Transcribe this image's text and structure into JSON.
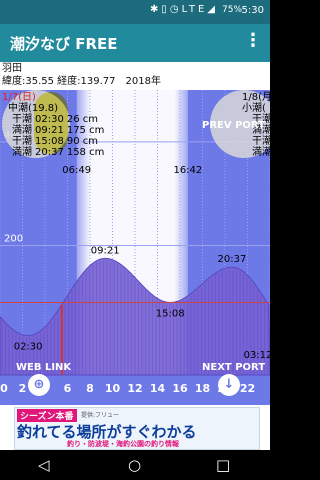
{
  "status_bar": {
    "time": "5:30",
    "battery": "75%",
    "network": "LTE",
    "icons": [
      "bluetooth-icon",
      "vibrate-icon",
      "alarm-icon",
      "wifi-icon",
      "signal-icon",
      "battery-icon"
    ]
  },
  "app_bar": {
    "title": "潮汐なび FREE",
    "menu_icon": "overflow-menu-icon"
  },
  "location": {
    "name": "羽田",
    "coords": "緯度:35.55 経度:139.77　2018年"
  },
  "left_panel": {
    "date": "1/7(日)",
    "tide_type": "中潮(19.8)",
    "rows": [
      {
        "label": "干潮",
        "time": "02:30",
        "level": "26 cm"
      },
      {
        "label": "満潮",
        "time": "09:21",
        "level": "175 cm"
      },
      {
        "label": "干潮",
        "time": "15:08",
        "level": "90 cm"
      },
      {
        "label": "満潮",
        "time": "20:37",
        "level": "158 cm"
      }
    ]
  },
  "right_panel": {
    "date": "1/8(月)",
    "tide_type": "小潮(",
    "rows": [
      {
        "label": "干潮",
        "time": ""
      },
      {
        "label": "満潮",
        "time": ""
      },
      {
        "label": "干潮",
        "time": ""
      },
      {
        "label": "満潮",
        "time": ""
      }
    ]
  },
  "buttons": {
    "prev_port": "PREV PORT",
    "web_link": "WEB LINK",
    "next_port": "NEXT PORT"
  },
  "chart_data": {
    "type": "area",
    "sunrise": "06:49",
    "sunset": "16:42",
    "sunrise_hour": 6.82,
    "sunset_hour": 16.7,
    "current_hour": 5.5,
    "xlim": [
      0,
      24
    ],
    "ylim": [
      -50,
      500
    ],
    "y_ticks": [
      200,
      400
    ],
    "x_ticks": [
      0,
      2,
      4,
      6,
      8,
      10,
      12,
      14,
      16,
      18,
      20,
      22,
      24
    ],
    "x_tick_labels": [
      "0",
      "2",
      "4",
      "6",
      "8",
      "10",
      "12",
      "14",
      "16",
      "18",
      "20",
      "22"
    ],
    "reference_level": 90,
    "tide_points": [
      {
        "hour": 2.5,
        "level": 26,
        "label": "02:30"
      },
      {
        "hour": 9.35,
        "level": 175,
        "label": "09:21"
      },
      {
        "hour": 15.13,
        "level": 90,
        "label": "15:08"
      },
      {
        "hour": 20.62,
        "level": 158,
        "label": "20:37"
      },
      {
        "hour": 27.17,
        "level": 10,
        "label": "03:12"
      }
    ],
    "colors": {
      "night": "#6e79e8",
      "day": "#ffffff",
      "fill": "#7662d2",
      "current_line": "#d33333",
      "reference_line": "#cc4444"
    }
  },
  "ad": {
    "tag": "シーズン本番",
    "sponsor": "提供:フリュー",
    "headline": "釣れてる場所がすぐわかる",
    "sub": "釣り・防波堤・海釣公園の釣り情報"
  },
  "nav": {
    "back": "◁",
    "home": "○",
    "recents": "□"
  }
}
